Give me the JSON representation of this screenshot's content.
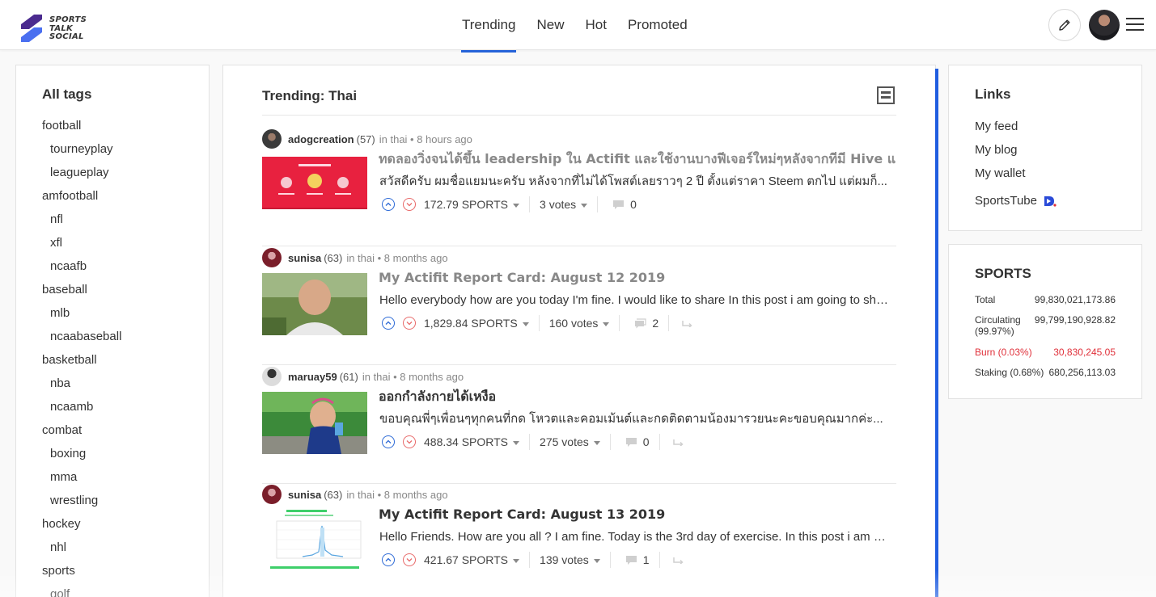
{
  "brand": {
    "logo_line1": "SPORTS",
    "logo_line2": "TALK",
    "logo_line3": "SOCIAL",
    "accent": "#2563d9"
  },
  "nav": {
    "tabs": [
      {
        "label": "Trending",
        "active": true
      },
      {
        "label": "New"
      },
      {
        "label": "Hot"
      },
      {
        "label": "Promoted"
      }
    ]
  },
  "header_actions": {
    "compose_icon": "pencil-icon",
    "menu_icon": "hamburger-icon"
  },
  "tags": {
    "title": "All tags",
    "items": [
      {
        "label": "football"
      },
      {
        "label": "tourneyplay",
        "child": true
      },
      {
        "label": "leagueplay",
        "child": true
      },
      {
        "label": "amfootball"
      },
      {
        "label": "nfl",
        "child": true
      },
      {
        "label": "xfl",
        "child": true
      },
      {
        "label": "ncaafb",
        "child": true
      },
      {
        "label": "baseball"
      },
      {
        "label": "mlb",
        "child": true
      },
      {
        "label": "ncaabaseball",
        "child": true
      },
      {
        "label": "basketball"
      },
      {
        "label": "nba",
        "child": true
      },
      {
        "label": "ncaamb",
        "child": true
      },
      {
        "label": "combat"
      },
      {
        "label": "boxing",
        "child": true
      },
      {
        "label": "mma",
        "child": true
      },
      {
        "label": "wrestling",
        "child": true
      },
      {
        "label": "hockey"
      },
      {
        "label": "nhl",
        "child": true
      },
      {
        "label": "sports"
      },
      {
        "label": "golf",
        "child": true
      }
    ]
  },
  "feed": {
    "title": "Trending: Thai",
    "posts": [
      {
        "author": "adogcreation",
        "rep": "(57)",
        "meta": "in thai • 8 hours ago",
        "title": "ทดลองวิ่งจนได้ขึ้น leadership ใน Actifit และใช้งานบางฟีเจอร์ใหม่ๆหลังจากทีมี Hive แล้ว",
        "summary": "สวัสดีครับ ผมชื่อแยมนะครับ หลังจากที่ไม่ได้โพสต์เลยราวๆ 2 ปี ตั้งแต่ราคา Steem ตกไป แต่ผมก็...",
        "payout": "172.79 SPORTS",
        "votes": "3 votes",
        "comments": "0",
        "visited": true,
        "reblog": false
      },
      {
        "author": "sunisa",
        "rep": "(63)",
        "meta": "in thai • 8 months ago",
        "title": "My Actifit Report Card: August 12 2019",
        "summary": "Hello everybody how are you today I'm fine. I would like to share In this post i am going to share...",
        "payout": "1,829.84 SPORTS",
        "votes": "160 votes",
        "comments": "2",
        "visited": true,
        "reblog": true
      },
      {
        "author": "maruay59",
        "rep": "(61)",
        "meta": "in thai • 8 months ago",
        "title": "ออกกำลังกายได้เหงือ",
        "summary": "ขอบคุณพี่ๆเพื่อนๆทุกคนที่กด โหวตและคอมเม้นต์และกดติดตามน้องมารวยนะคะขอบคุณมากค่ะ...",
        "payout": "488.34 SPORTS",
        "votes": "275 votes",
        "comments": "0",
        "visited": false,
        "reblog": true
      },
      {
        "author": "sunisa",
        "rep": "(63)",
        "meta": "in thai • 8 months ago",
        "title": "My Actifit Report Card: August 13 2019",
        "summary": "Hello Friends. How are you all ? I am fine. Today is the 3rd day of exercise. In this post i am going...",
        "payout": "421.67 SPORTS",
        "votes": "139 votes",
        "comments": "1",
        "visited": false,
        "reblog": true
      }
    ]
  },
  "links": {
    "title": "Links",
    "items": [
      {
        "label": "My feed"
      },
      {
        "label": "My blog"
      },
      {
        "label": "My wallet"
      },
      {
        "label": "SportsTube"
      }
    ]
  },
  "sports": {
    "title": "SPORTS",
    "rows": [
      {
        "label": "Total",
        "value": "99,830,021,173.86"
      },
      {
        "label": "Circulating\n(99.97%)",
        "value": "99,799,190,928.82"
      },
      {
        "label": "Burn (0.03%)",
        "value": "30,830,245.05",
        "color": "#e0303a"
      },
      {
        "label": "Staking (0.68%)",
        "value": "680,256,113.03"
      }
    ]
  }
}
